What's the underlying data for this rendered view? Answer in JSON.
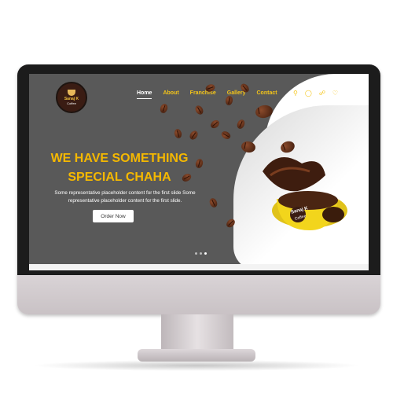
{
  "site": {
    "logo": {
      "name": "Sanaj K",
      "tagline": "Coffee"
    },
    "nav": [
      {
        "label": "Home",
        "active": true
      },
      {
        "label": "About",
        "active": false
      },
      {
        "label": "Franchise",
        "active": false
      },
      {
        "label": "Gallery",
        "active": false
      },
      {
        "label": "Contact",
        "active": false
      }
    ],
    "icons": [
      "search-icon",
      "user-icon",
      "cart-icon",
      "heart-icon"
    ],
    "hero": {
      "headline_line1": "WE HAVE SOMETHING",
      "headline_line2": "SPECIAL CHAHA",
      "subtitle": "Some representative placeholder content for the first slide Some representative placeholder content for the first slide.",
      "button_label": "Order Now",
      "mug_label_1": "Sanaj K",
      "mug_label_2": "Coffee",
      "slide_count": 3,
      "active_slide": 3
    },
    "colors": {
      "background": "#595959",
      "accent": "#f5b800",
      "text": "#ffffff"
    }
  }
}
